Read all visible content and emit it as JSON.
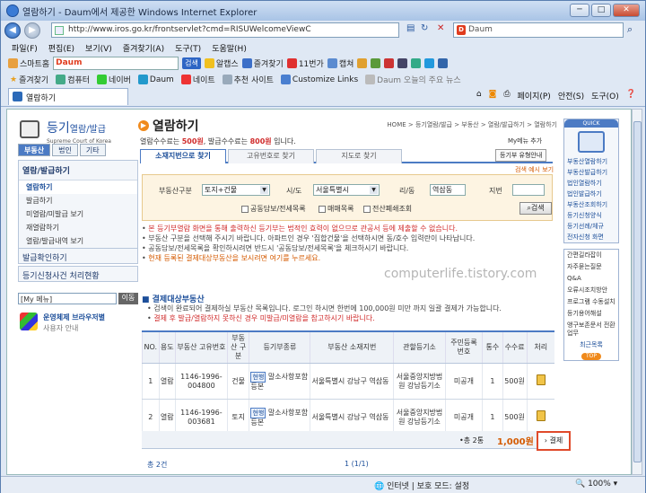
{
  "window": {
    "title": "열람하기 - Daum에서 제공한 Windows Internet Explorer",
    "btn_min": "─",
    "btn_max": "□",
    "btn_close": "✕"
  },
  "address": {
    "url": "http://www.iros.go.kr/frontservlet?cmd=RISUWelcomeViewC",
    "search_placeholder": "Daum",
    "search_badge": "D"
  },
  "menu": [
    "파일(F)",
    "편집(E)",
    "보기(V)",
    "즐겨찾기(A)",
    "도구(T)",
    "도움말(H)"
  ],
  "toolbar1": {
    "smarthome": "스마트홈",
    "daum_logo": "Daum",
    "search_btn": "검색",
    "items": [
      "알캡스",
      "즐겨찾기",
      "11번가",
      "캡쳐"
    ]
  },
  "toolbar2": {
    "favorites": "즐겨찾기",
    "items": [
      "컴퓨터",
      "네이버",
      "Daum",
      "네이트",
      "추천 사이트",
      "Customize Links",
      "Daum 오늘의 주요 뉴스"
    ]
  },
  "tab": {
    "label": "열람하기"
  },
  "commands": [
    "페이지(P)",
    "안전(S)",
    "도구(O)"
  ],
  "left": {
    "logo_main": "등기",
    "logo_sub": "열람/발급",
    "logo_en": "Supreme Court of Korea",
    "tabs": [
      "부동산",
      "법인",
      "기타"
    ],
    "menu_title": "열람/발급하기",
    "menu_items": [
      "열람하기",
      "발급하기",
      "미열람/미발급 보기",
      "재열람하기",
      "열람/발급내역 보기"
    ],
    "box1": "발급확인하기",
    "box2": "등기신청사건 처리현황",
    "mymenu": "[My 메뉴]",
    "mymenu_btn": "이동",
    "browser_title": "운영체제 브라우저별",
    "browser_sub": "사용자 안내"
  },
  "main": {
    "title": "열람하기",
    "breadcrumb": "HOME > 등기열람/발급 > 부동산 > 열람/발급하기 > 열람하기",
    "fee_prefix": "열람수수료는 ",
    "fee_view": "500원",
    "fee_mid": ", 발급수수료는 ",
    "fee_issue": "800원",
    "fee_suffix": " 입니다.",
    "mymenu_add": "My메뉴 추가",
    "tabs": [
      "소재지번으로 찾기",
      "고유번호로 찾기",
      "지도로 찾기"
    ],
    "guide": "등기부 유형안내",
    "example": "검색 예시 보기",
    "form": {
      "type_label": "부동산구분",
      "type_value": "토지+건물",
      "sido_label": "시/도",
      "sido_value": "서울특별시",
      "dong_label": "리/동",
      "dong_value": "역삼동",
      "jibun_label": "지번",
      "checks": [
        "공동담보/전세목록",
        "매매목록",
        "전산폐쇄조회"
      ],
      "search_btn": "검색"
    },
    "notes": [
      "본 등기부열람 화면을 통해 출력하신 등기부는 법적인 효력이 없으므로 관공서 등에 제출할 수 없습니다.",
      "부동산 구분을 선택해 주시기 바랍니다. 아파트인 경우 '집합건물'을 선택하시면 동/호수 입력란이 나타납니다.",
      "공동담보/전세목록을 확인하시려면 반드시 '공동담보/전세목록'을 체크하시기 바랍니다.",
      "현재 등록된 결제대상부동산을 보시려면 여기를 누르세요."
    ],
    "watermark": "computerlife.tistory.com",
    "section_title": "결제대상부동산",
    "section_notes": [
      "검색이 완료되어 결제하실 부동산 목록입니다. 로그인 하시면 한번에 100,000원 미만 까지 일괄 결제가 가능합니다.",
      "결제 후 발급/열람하지 못하신 경우 미발급/미열람을 참고하시기 바랍니다."
    ],
    "table": {
      "headers": [
        "NO.",
        "용도",
        "부동산 고유번호",
        "부동산 구분",
        "등기부종류",
        "부동산 소재지번",
        "관할등기소",
        "주민등록 번호",
        "통수",
        "수수료",
        "처리"
      ],
      "rows": [
        {
          "no": "1",
          "use": "열람",
          "id": "1146-1996-004800",
          "kind": "건물",
          "tag": "현행",
          "doctype": "말소사항포함등본",
          "addr": "서울특별시 강남구 역삼동",
          "office": "서울중앙지방법원 강남등기소",
          "rrn": "미공개",
          "copies": "1",
          "fee": "500원"
        },
        {
          "no": "2",
          "use": "열람",
          "id": "1146-1996-003681",
          "kind": "토지",
          "tag": "현행",
          "doctype": "말소사항포함등본",
          "addr": "서울특별시 강남구 역삼동",
          "office": "서울중앙지방법원 강남등기소",
          "rrn": "미공개",
          "copies": "1",
          "fee": "500원"
        }
      ]
    },
    "total_label": "•총 2통",
    "total_amount": "1,000원",
    "pay_btn": "결제",
    "count": "총 2건",
    "pager": "1 (1/1)"
  },
  "quick": {
    "header": "QUICK",
    "items": [
      "부동산열람하기",
      "부동산발급하기",
      "법인열람하기",
      "법인발급하기",
      "부동산조회하기",
      "등기신청양식",
      "등기선례/체규",
      "전자신청 화면"
    ],
    "items2": [
      "간편길라잡이",
      "자주묻는질문",
      "Q&A",
      "오류시조치방안",
      "프로그램 수동설치",
      "등기용어해설",
      "앵구보존문서 전환업무"
    ],
    "recent": "최근목록",
    "top": "TOP"
  },
  "status": {
    "zone": "인터넷 | 보호 모드: 설정",
    "zoom": "100%"
  }
}
